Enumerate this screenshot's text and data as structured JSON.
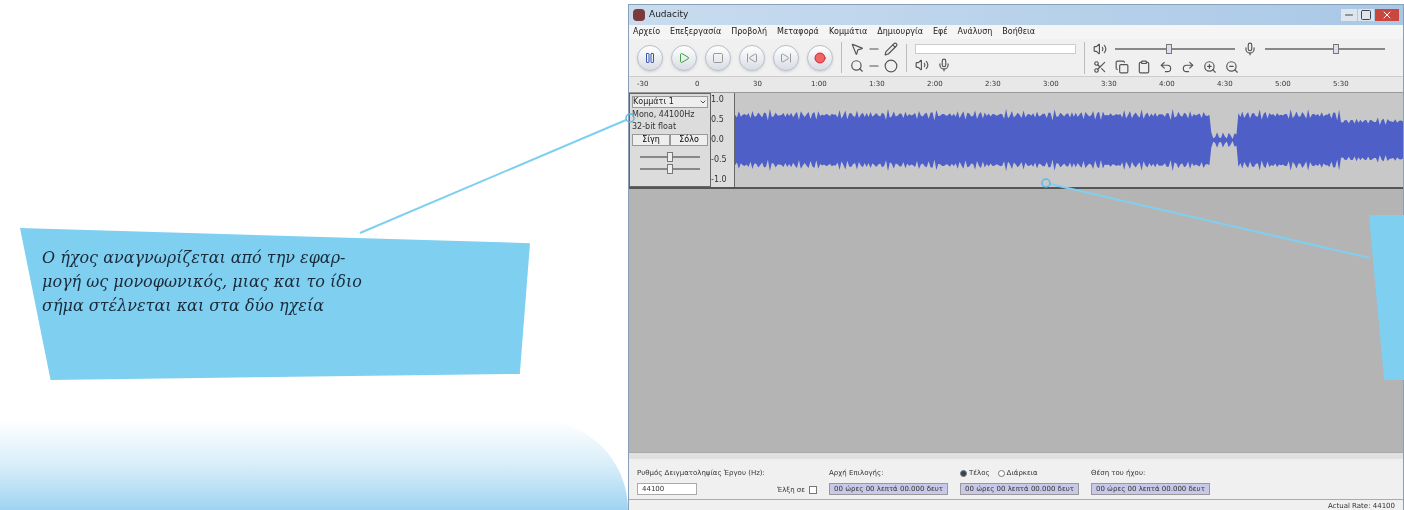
{
  "window": {
    "title": "Audacity"
  },
  "menu": [
    "Αρχείο",
    "Επεξεργασία",
    "Προβολή",
    "Μεταφορά",
    "Κομμάτια",
    "Δημιουργία",
    "Εφέ",
    "Ανάλυση",
    "Βοήθεια"
  ],
  "ruler": [
    "-30",
    "0",
    "30",
    "1:00",
    "1:30",
    "2:00",
    "2:30",
    "3:00",
    "3:30",
    "4:00",
    "4:30",
    "5:00",
    "5:30"
  ],
  "meters": [
    {
      "kind": "output",
      "level": 0.45
    },
    {
      "kind": "input",
      "level": 0.6
    }
  ],
  "track": {
    "name": "Κομμάτι 1",
    "sliders": [
      {
        "level": 0.5
      },
      {
        "level": 0.5
      }
    ],
    "info": [
      "Mono, 44100Hz",
      "32-bit float"
    ],
    "buttons": [
      {
        "label": "Σίγη",
        "selected": false
      },
      {
        "label": "Σόλο",
        "selected": false
      }
    ],
    "scale": [
      "1.0",
      "0.5",
      "0.0",
      "-0.5",
      "-1.0"
    ]
  },
  "selection_bar": {
    "rate_label": "Ρυθμός Δειγματοληψίας Έργου (Hz):",
    "rate": "44100",
    "snap_label": "Έλξη σε",
    "snap_checked": false,
    "start_label": "Αρχή Επιλογής:",
    "start": "00 ώρες 00 λεπτά 00.000 δευτ",
    "end_options": [
      {
        "label": "Τέλος",
        "selected": true
      },
      {
        "label": "Διάρκεια",
        "selected": false
      }
    ],
    "end": "00 ώρες 00 λεπτά 00.000 δευτ",
    "position_label": "Θέση του ήχου:",
    "position": "00 ώρες 00 λεπτά 00.000 δευτ"
  },
  "status_bar": "Actual Rate: 44100",
  "callout": {
    "lines": [
      "Ο ήχος αναγνωρίζεται από την εφαρ-",
      "μογή ως μονοφωνικός, μιας και το ίδιο",
      "σήμα στέλνεται και στα δύο ηχεία"
    ]
  }
}
